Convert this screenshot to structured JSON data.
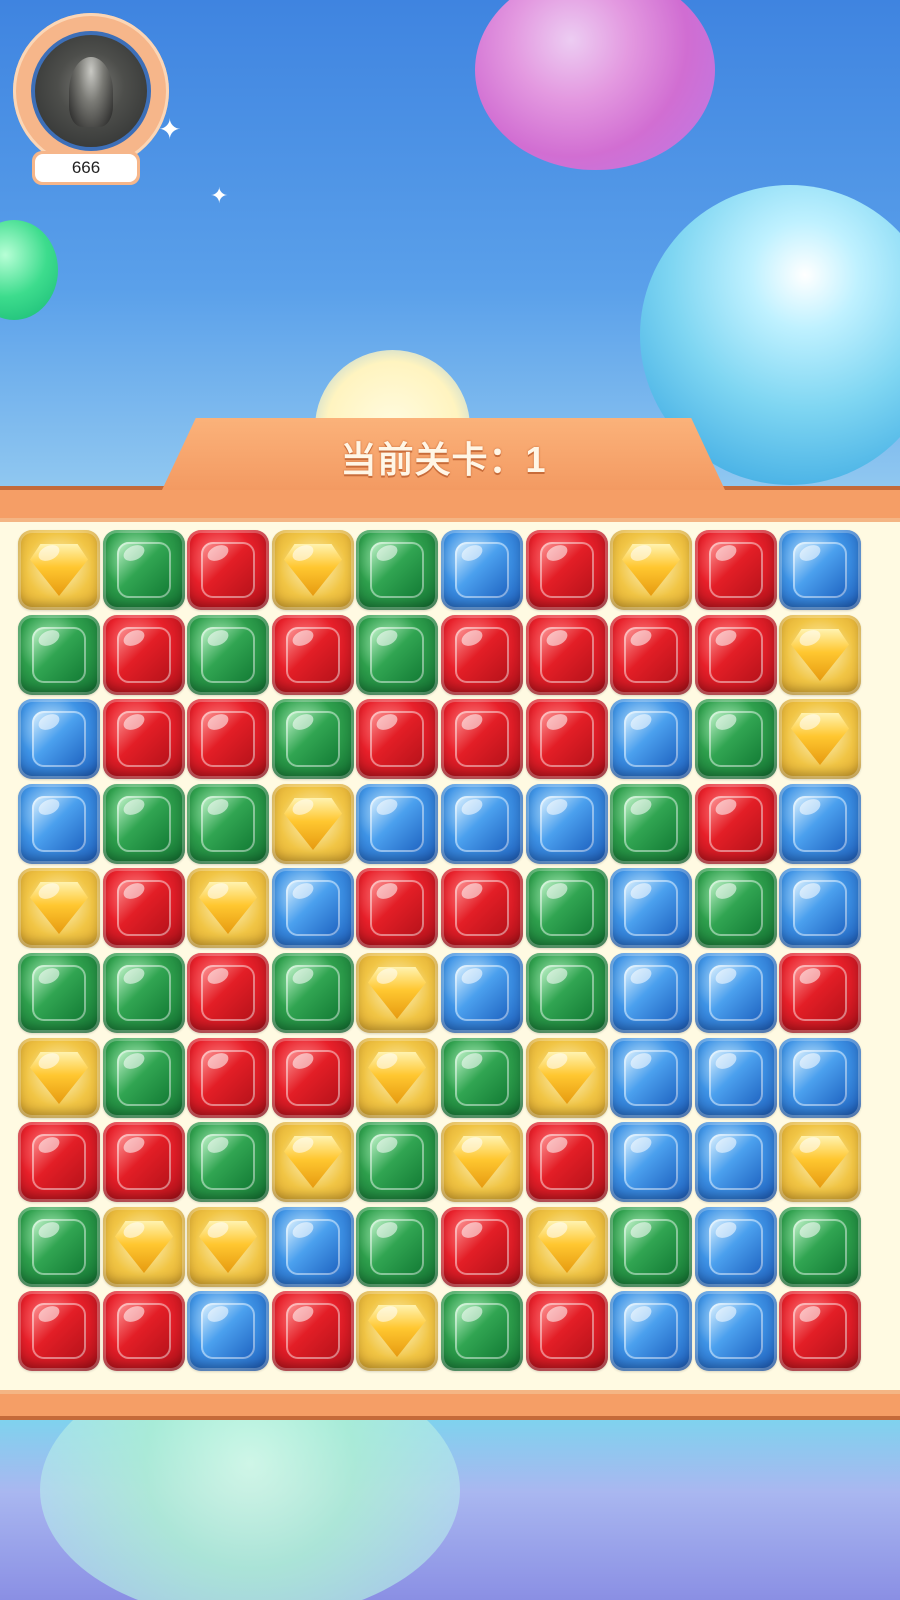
{
  "player": {
    "score": "666"
  },
  "level": {
    "label": "当前关卡：1"
  },
  "board": {
    "rows": 10,
    "cols": 10,
    "gems": [
      [
        "yellow",
        "green",
        "red",
        "yellow",
        "green",
        "blue",
        "red",
        "yellow",
        "red",
        "blue"
      ],
      [
        "green",
        "red",
        "green",
        "red",
        "green",
        "red",
        "red",
        "red",
        "red",
        "yellow"
      ],
      [
        "blue",
        "red",
        "red",
        "green",
        "red",
        "red",
        "red",
        "blue",
        "green",
        "yellow"
      ],
      [
        "blue",
        "green",
        "green",
        "yellow",
        "blue",
        "blue",
        "blue",
        "green",
        "red",
        "blue"
      ],
      [
        "yellow",
        "red",
        "yellow",
        "blue",
        "red",
        "red",
        "green",
        "blue",
        "green",
        "blue"
      ],
      [
        "green",
        "green",
        "red",
        "green",
        "yellow",
        "blue",
        "green",
        "blue",
        "blue",
        "red"
      ],
      [
        "yellow",
        "green",
        "red",
        "red",
        "yellow",
        "green",
        "yellow",
        "blue",
        "blue",
        "blue"
      ],
      [
        "red",
        "red",
        "green",
        "yellow",
        "green",
        "yellow",
        "red",
        "blue",
        "blue",
        "yellow"
      ],
      [
        "green",
        "yellow",
        "yellow",
        "blue",
        "green",
        "red",
        "yellow",
        "green",
        "blue",
        "green"
      ],
      [
        "red",
        "red",
        "blue",
        "red",
        "yellow",
        "green",
        "red",
        "blue",
        "blue",
        "red"
      ]
    ]
  }
}
